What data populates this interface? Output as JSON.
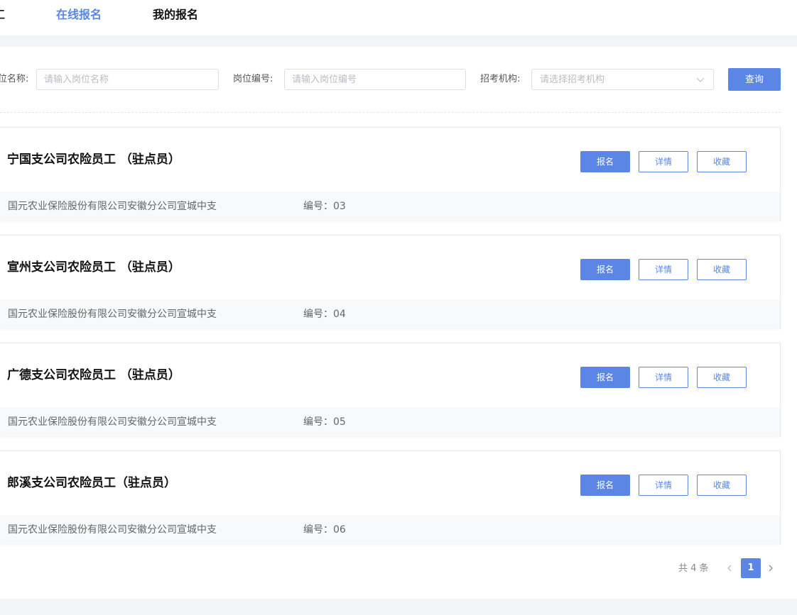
{
  "nav": {
    "cut_item": "工",
    "online_apply": "在线报名",
    "my_apply": "我的报名"
  },
  "filters": {
    "name_label": "位名称:",
    "name_placeholder": "请输入岗位名称",
    "code_label": "岗位编号:",
    "code_placeholder": "请输入岗位编号",
    "org_label": "招考机构:",
    "org_placeholder": "请选择招考机构",
    "query_label": "查询"
  },
  "jobs": [
    {
      "title": "宁国支公司农险员工 （驻点员）",
      "org": "国元农业保险股份有限公司安徽分公司宣城中支",
      "code": "编号：03",
      "apply": "报名",
      "detail": "详情",
      "favorite": "收藏"
    },
    {
      "title": "宣州支公司农险员工 （驻点员）",
      "org": "国元农业保险股份有限公司安徽分公司宣城中支",
      "code": "编号：04",
      "apply": "报名",
      "detail": "详情",
      "favorite": "收藏"
    },
    {
      "title": "广德支公司农险员工 （驻点员）",
      "org": "国元农业保险股份有限公司安徽分公司宣城中支",
      "code": "编号：05",
      "apply": "报名",
      "detail": "详情",
      "favorite": "收藏"
    },
    {
      "title": "郎溪支公司农险员工（驻点员）",
      "org": "国元农业保险股份有限公司安徽分公司宣城中支",
      "code": "编号：06",
      "apply": "报名",
      "detail": "详情",
      "favorite": "收藏"
    }
  ],
  "pagination": {
    "total": "共 4 条",
    "current_page": "1"
  },
  "colors": {
    "accent": "#5b86e5",
    "page_bg": "#f4f5f8",
    "card_footer_bg": "#f7f9fb"
  }
}
